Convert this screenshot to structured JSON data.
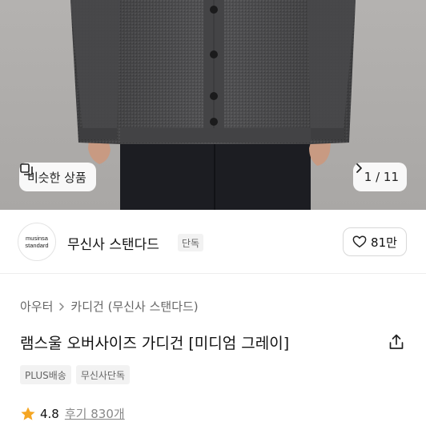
{
  "gallery": {
    "similar_label": "비슷한 상품",
    "page_indicator": "1 / 11"
  },
  "brand": {
    "logo_line1": "musinsa",
    "logo_line2": "standard",
    "name": "무신사 스탠다드",
    "badge": "단독",
    "like_count": "81만"
  },
  "breadcrumb": {
    "items": [
      "아우터",
      "카디건 (무신사 스탠다드)"
    ]
  },
  "product": {
    "title": "램스울 오버사이즈 가디건 [미디엄 그레이]",
    "tags": [
      "PLUS배송",
      "무신사단독"
    ]
  },
  "rating": {
    "score": "4.8",
    "reviews": "후기 830개"
  },
  "colors": {
    "star": "#f5a623",
    "badge_bg": "#f2f2f2",
    "cardigan": "#4e4e4f",
    "trousers": "#1c1d22"
  },
  "icons": [
    "similar-items-icon",
    "chevron-right-icon",
    "heart-icon",
    "share-icon",
    "star-icon"
  ]
}
